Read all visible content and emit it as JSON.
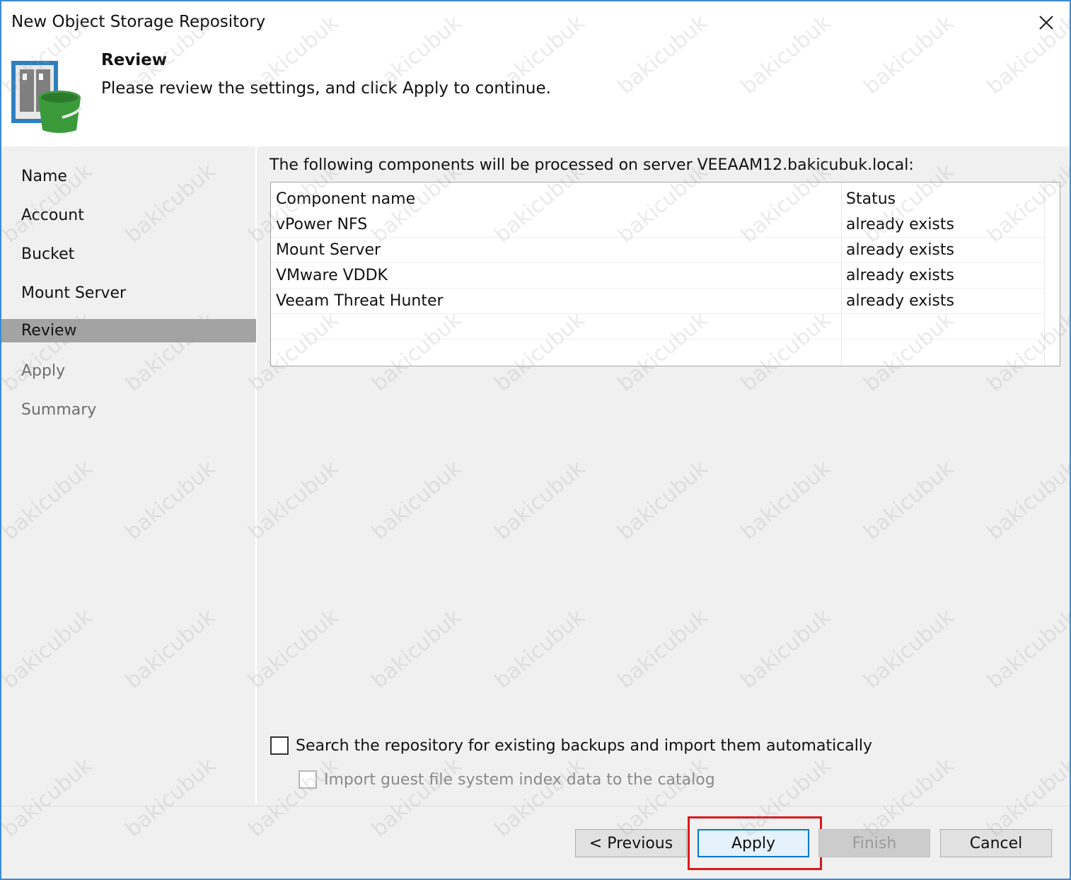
{
  "window": {
    "title": "New Object Storage Repository",
    "close_icon": "close-icon"
  },
  "header": {
    "title": "Review",
    "description": "Please review the settings, and click Apply to continue.",
    "icon": "object-storage-bucket-icon"
  },
  "sidebar": {
    "steps": [
      {
        "label": "Name",
        "state": "completed"
      },
      {
        "label": "Account",
        "state": "completed"
      },
      {
        "label": "Bucket",
        "state": "completed"
      },
      {
        "label": "Mount Server",
        "state": "completed"
      },
      {
        "label": "Review",
        "state": "active"
      },
      {
        "label": "Apply",
        "state": "disabled"
      },
      {
        "label": "Summary",
        "state": "disabled"
      }
    ]
  },
  "main": {
    "label": "The following components will be processed on server VEEAAM12.bakicubuk.local:",
    "table": {
      "columns": [
        "Component name",
        "Status"
      ],
      "rows": [
        [
          "vPower NFS",
          "already exists"
        ],
        [
          "Mount Server",
          "already exists"
        ],
        [
          "VMware VDDK",
          "already exists"
        ],
        [
          "Veeam Threat Hunter",
          "already exists"
        ]
      ]
    },
    "options": {
      "search_backups": {
        "label": "Search the repository for existing backups and import them automatically",
        "checked": false,
        "enabled": true
      },
      "import_index": {
        "label": "Import guest file system index data to the catalog",
        "checked": false,
        "enabled": false
      }
    }
  },
  "footer": {
    "previous": "< Previous",
    "apply": "Apply",
    "finish": "Finish",
    "cancel": "Cancel"
  },
  "colors": {
    "window_border": "#3a8bd4",
    "active_step": "#a3a3a3",
    "highlight": "#d9191c",
    "primary_border": "#0078d7"
  },
  "watermark": "bakicubuk"
}
